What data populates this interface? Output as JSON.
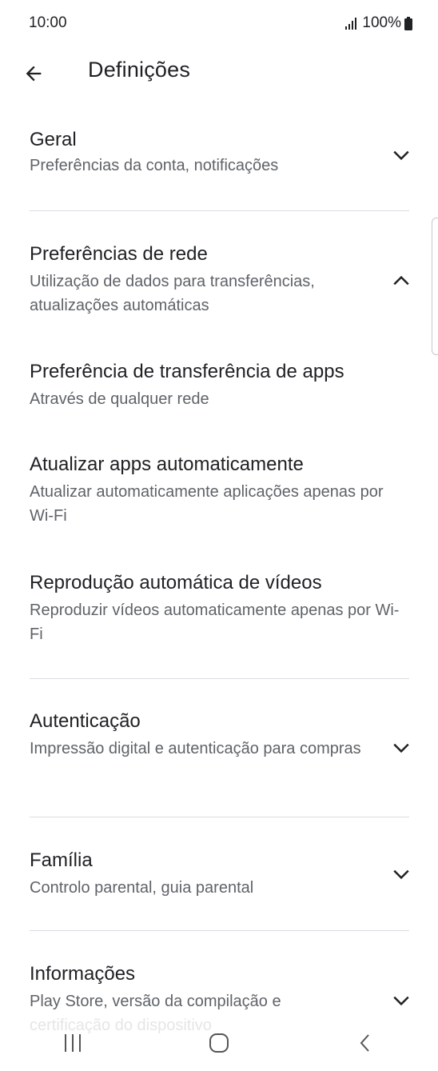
{
  "status_bar": {
    "time": "10:00",
    "battery": "100%"
  },
  "app_bar": {
    "title": "Definições"
  },
  "sections": {
    "geral": {
      "title": "Geral",
      "subtitle": "Preferências da conta, notificações"
    },
    "rede": {
      "title": "Preferências de rede",
      "subtitle": "Utilização de dados para transferências, atualizações automáticas",
      "items": [
        {
          "title": "Preferência de transferência de apps",
          "subtitle": "Através de qualquer rede"
        },
        {
          "title": "Atualizar apps automaticamente",
          "subtitle": "Atualizar automaticamente aplicações apenas por Wi-Fi"
        },
        {
          "title": "Reprodução automática de vídeos",
          "subtitle": "Reproduzir vídeos automaticamente apenas por Wi-Fi"
        }
      ]
    },
    "autenticacao": {
      "title": "Autenticação",
      "subtitle": "Impressão digital e autenticação para compras"
    },
    "familia": {
      "title": "Família",
      "subtitle": "Controlo parental, guia parental"
    },
    "informacoes": {
      "title": "Informações",
      "subtitle": "Play Store, versão da compilação e",
      "subtitle_faded": "certificação do dispositivo"
    }
  },
  "icons": {
    "back": "arrow-left-icon",
    "expand": "chevron-down-icon",
    "collapse": "chevron-up-icon",
    "nav_recents": "recents-icon",
    "nav_home": "home-icon",
    "nav_back": "nav-back-icon"
  },
  "colors": {
    "text_primary": "#202124",
    "text_secondary": "#5f6368",
    "divider": "#dadce0"
  }
}
